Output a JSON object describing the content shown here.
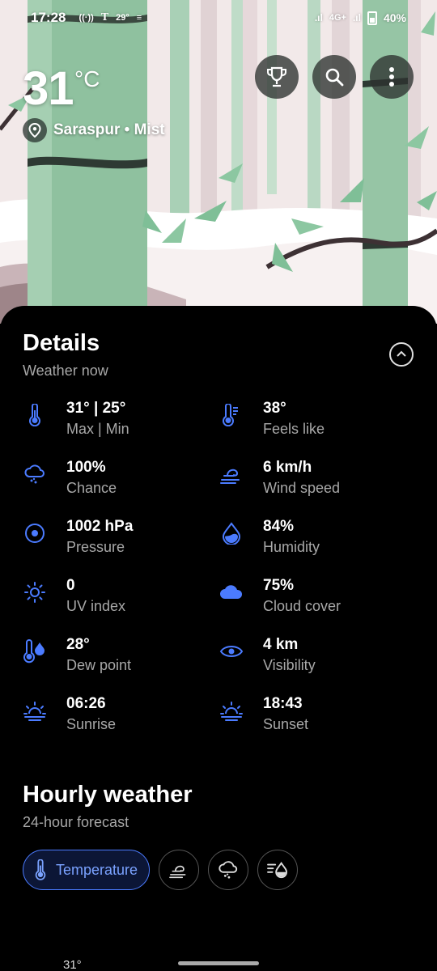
{
  "status_bar": {
    "time": "17:28",
    "small_temp": "29°",
    "battery": "40%",
    "network": "4G+"
  },
  "current": {
    "temperature": "31",
    "unit": "°C",
    "location": "Saraspur • Mist"
  },
  "details": {
    "title": "Details",
    "subtitle": "Weather now",
    "items": [
      {
        "value": "31° | 25°",
        "label": "Max | Min",
        "icon": "thermometer-icon"
      },
      {
        "value": "38°",
        "label": "Feels like",
        "icon": "feels-like-thermometer-icon"
      },
      {
        "value": "100%",
        "label": "Chance",
        "icon": "rain-cloud-icon"
      },
      {
        "value": "6 km/h",
        "label": "Wind speed",
        "icon": "wind-icon"
      },
      {
        "value": "1002 hPa",
        "label": "Pressure",
        "icon": "pressure-icon"
      },
      {
        "value": "84%",
        "label": "Humidity",
        "icon": "water-drop-icon"
      },
      {
        "value": "0",
        "label": "UV index",
        "icon": "sun-icon"
      },
      {
        "value": "75%",
        "label": "Cloud cover",
        "icon": "cloud-icon"
      },
      {
        "value": "28°",
        "label": "Dew point",
        "icon": "dew-point-icon"
      },
      {
        "value": "4 km",
        "label": "Visibility",
        "icon": "eye-icon"
      },
      {
        "value": "06:26",
        "label": "Sunrise",
        "icon": "sunrise-icon"
      },
      {
        "value": "18:43",
        "label": "Sunset",
        "icon": "sunset-icon"
      }
    ]
  },
  "hourly": {
    "title": "Hourly weather",
    "subtitle": "24-hour forecast",
    "chips": [
      {
        "label": "Temperature",
        "icon": "thermometer-icon",
        "selected": true
      },
      {
        "label": "",
        "icon": "wind-icon",
        "selected": false
      },
      {
        "label": "",
        "icon": "rain-cloud-icon",
        "selected": false
      },
      {
        "label": "",
        "icon": "humidity-icon",
        "selected": false
      }
    ],
    "first_temp": "31°"
  },
  "colors": {
    "accent": "#4b7bff",
    "background": "#000000",
    "secondary_text": "#a8a8a8"
  }
}
